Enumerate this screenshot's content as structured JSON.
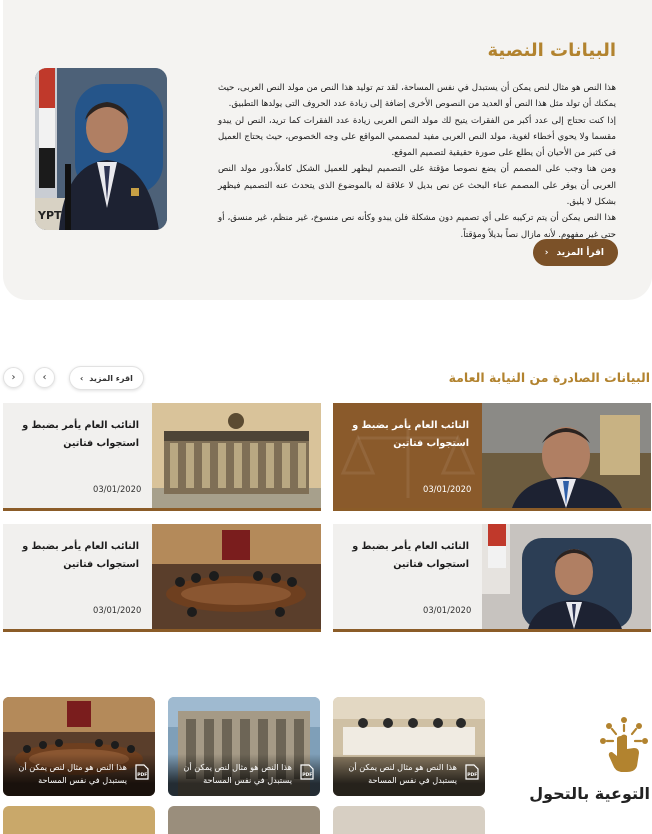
{
  "text_data": {
    "title": "البيانات النصية",
    "paragraphs": [
      "هذا النص هو مثال لنص يمكن أن يستبدل في نفس المساحة، لقد تم توليد هذا النص من مولد النص العربى، حيث يمكنك أن تولد مثل هذا النص أو العديد من النصوص الأخرى إضافة إلى زيادة عدد الحروف التى يولدها التطبيق.",
      "إذا كنت تحتاج إلى عدد أكبر من الفقرات يتيح لك مولد النص العربى زيادة عدد الفقرات كما تريد، النص لن يبدو مقسما ولا يحوي أخطاء لغوية، مولد النص العربى مفيد لمصممي المواقع على وجه الخصوص، حيث يحتاج العميل فى كثير من الأحيان أن يطلع على صورة حقيقية لتصميم الموقع.",
      "ومن هنا وجب على المصمم أن يضع نصوصا مؤقتة على التصميم ليظهر للعميل الشكل كاملاً،دور مولد النص العربى أن يوفر على المصمم عناء البحث عن نص بديل لا علاقة له بالموضوع الذى يتحدث عنه التصميم فيظهر بشكل لا يليق.",
      "هذا النص يمكن أن يتم تركيبه على أي تصميم دون مشكلة فلن يبدو وكأنه نص منسوخ، غير منظم، غير منسق، أو حتى غير مفهوم. لأنه مازال نصاً بديلاً ومؤقتاً."
    ],
    "read_more": "اقرأ المزيد"
  },
  "statements": {
    "title": "البيانات الصادرة من النيابة العامة",
    "read_more": "اقرء المزيد",
    "cards": [
      {
        "title": "النائب العام يأمر بضبط و استجواب فتاتين",
        "date": "03/01/2020"
      },
      {
        "title": "النائب العام يأمر بضبط و استجواب فتاتين",
        "date": "03/01/2020"
      },
      {
        "title": "النائب العام يأمر بضبط و استجواب فتاتين",
        "date": "03/01/2020"
      },
      {
        "title": "النائب العام يأمر بضبط و استجواب فتاتين",
        "date": "03/01/2020"
      }
    ]
  },
  "awareness": {
    "title": "التوعية بالتحول",
    "items": [
      {
        "caption": "هذا النص هو مثال لنص يمكن أن يستبدل في نفس المساحة"
      },
      {
        "caption": "هذا النص هو مثال لنص يمكن أن يستبدل في نفس المساحة"
      },
      {
        "caption": "هذا النص هو مثال لنص يمكن أن يستبدل في نفس المساحة"
      }
    ]
  },
  "colors": {
    "accent_gold": "#b2832f",
    "brown": "#7b5128",
    "card_bg": "#f1f0ee"
  },
  "icons": [
    "chevron-left-icon",
    "chevron-right-icon",
    "pdf-icon",
    "touch-hand-icon"
  ]
}
